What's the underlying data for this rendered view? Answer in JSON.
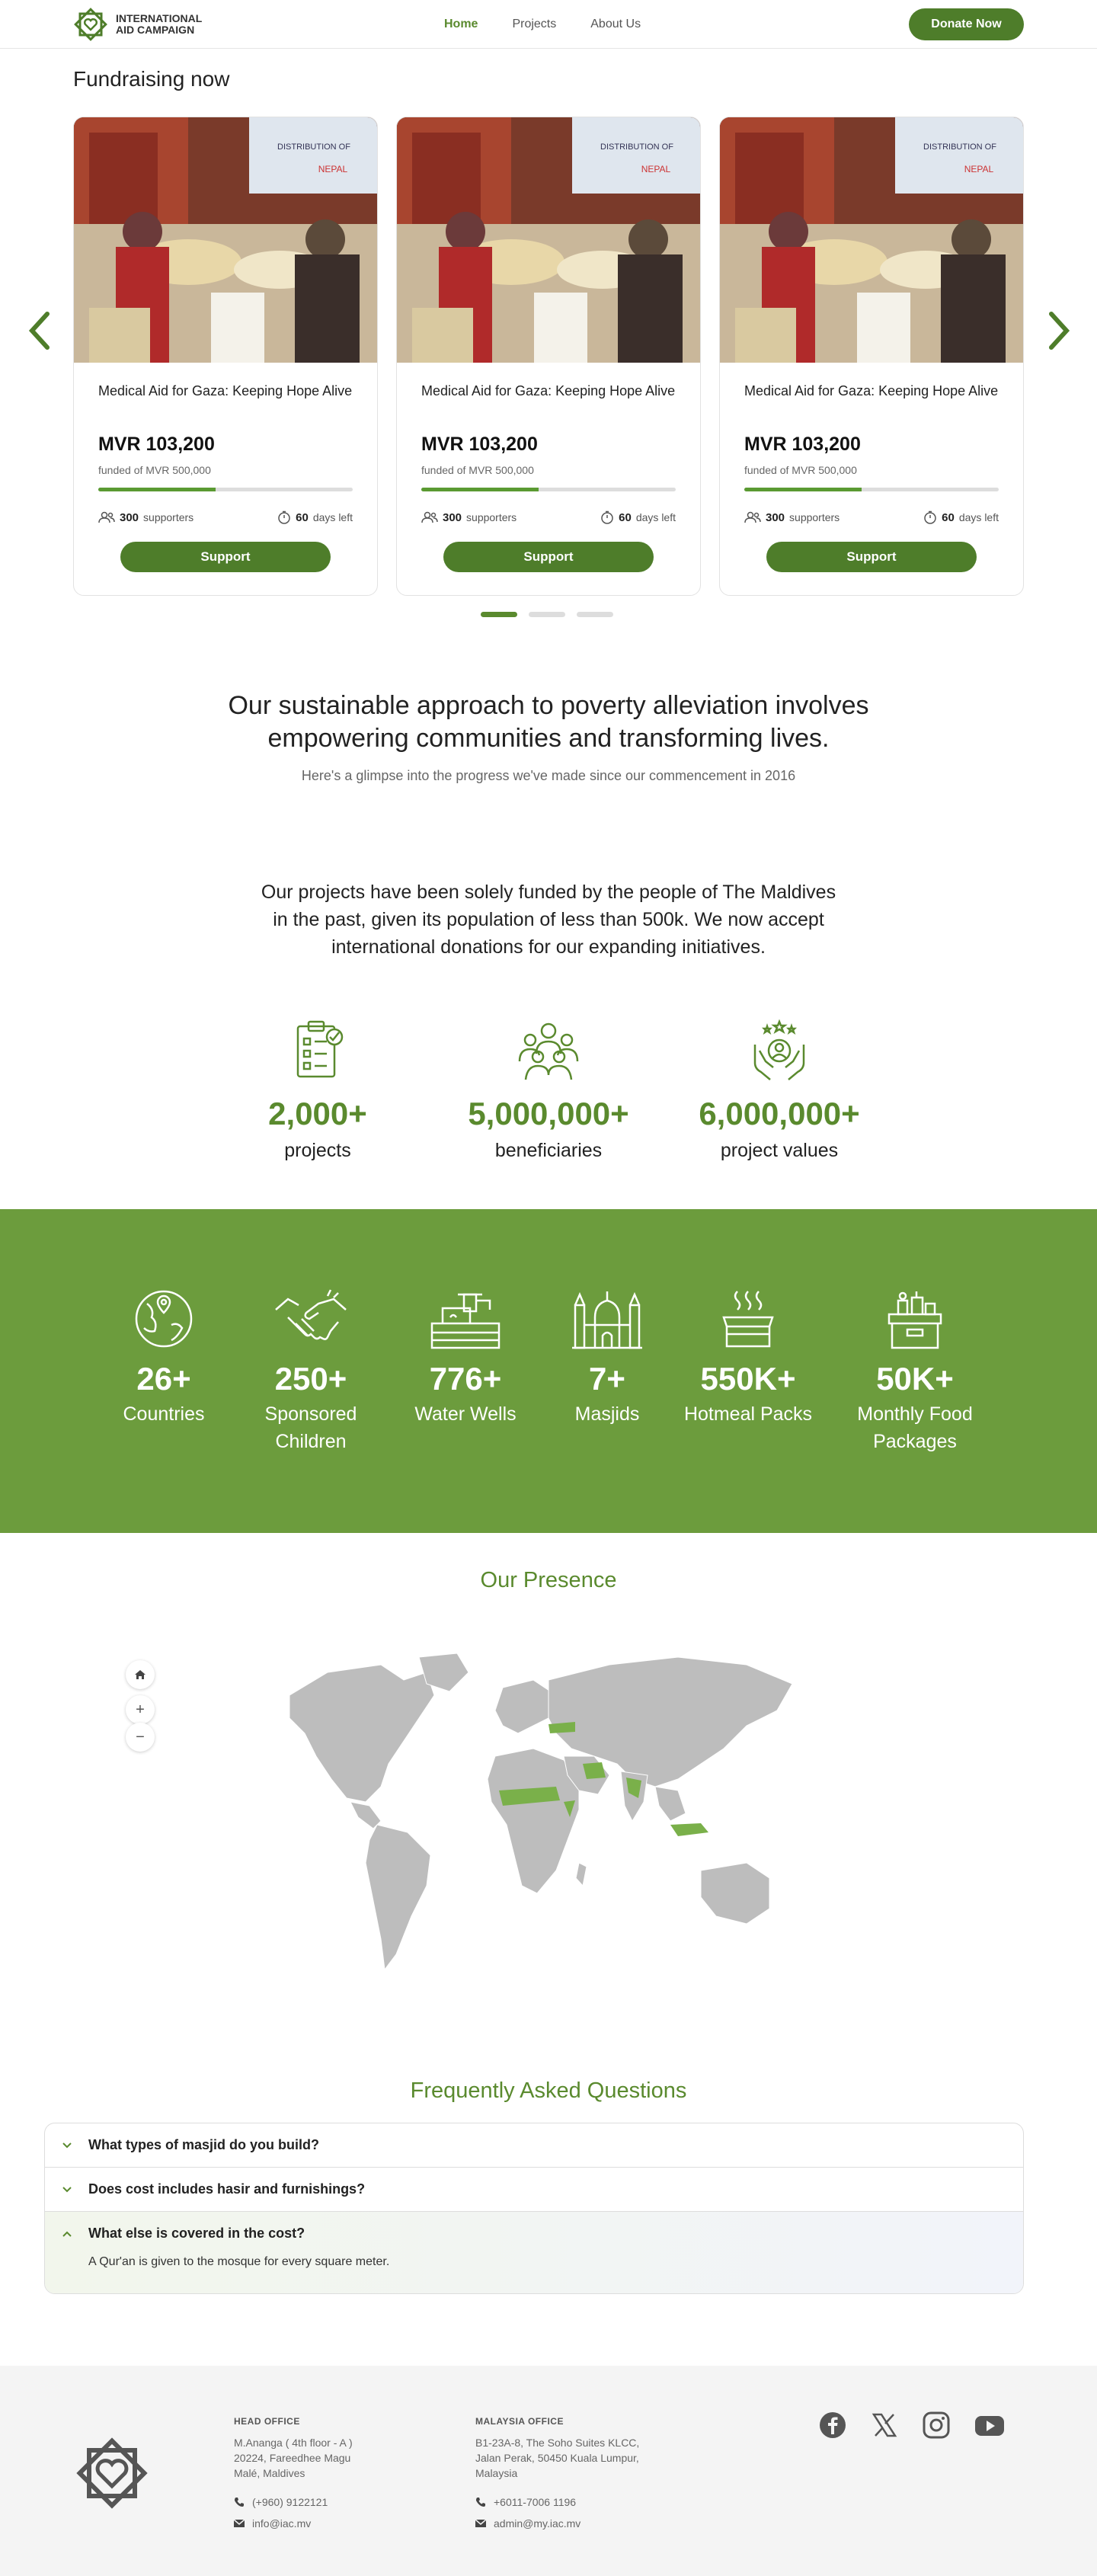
{
  "header": {
    "logo_line1": "INTERNATIONAL",
    "logo_line2": "AID CAMPAIGN",
    "nav": [
      "Home",
      "Projects",
      "About Us"
    ],
    "donate_label": "Donate Now"
  },
  "fundraising": {
    "heading": "Fundraising now",
    "cards": [
      {
        "title": "Medical Aid for Gaza: Keeping Hope Alive",
        "amount": "MVR 103,200",
        "funded": "funded of MVR 500,000",
        "progress": 0.46,
        "supporters": "300",
        "supporters_label": "supporters",
        "days": "60",
        "days_label": "days left",
        "button": "Support"
      },
      {
        "title": "Medical Aid for Gaza: Keeping Hope Alive",
        "amount": "MVR 103,200",
        "funded": "funded of MVR 500,000",
        "progress": 0.46,
        "supporters": "300",
        "supporters_label": "supporters",
        "days": "60",
        "days_label": "days left",
        "button": "Support"
      },
      {
        "title": "Medical Aid for Gaza: Keeping Hope Alive",
        "amount": "MVR 103,200",
        "funded": "funded of MVR 500,000",
        "progress": 0.46,
        "supporters": "300",
        "supporters_label": "supporters",
        "days": "60",
        "days_label": "days left",
        "button": "Support"
      }
    ],
    "image_banner_text": "DISTRIBUTION OF",
    "image_banner_sub": "NEPAL",
    "active_slide": 1,
    "slide_count": 3
  },
  "mission": {
    "headline_line1": "Our sustainable approach to poverty alleviation involves",
    "headline_line2": "empowering communities and transforming lives.",
    "subtext": "Here's a glimpse into the progress we've made since our commencement in 2016"
  },
  "funding": {
    "line1": "Our projects have been solely funded by the people of The Maldives",
    "line2": "in the past, given its population of less than 500k. We now accept",
    "line3": "international donations for our expanding initiatives."
  },
  "impact": [
    {
      "icon": "clipboard-check-icon",
      "value": "2,000+",
      "label": "projects"
    },
    {
      "icon": "community-icon",
      "value": "5,000,000+",
      "label": "beneficiaries"
    },
    {
      "icon": "hands-star-icon",
      "value": "6,000,000+",
      "label": "project values"
    }
  ],
  "achievements": [
    {
      "icon": "globe-icon",
      "value": "26+",
      "label": "Countries"
    },
    {
      "icon": "handshake-icon",
      "value": "250+",
      "label": "Sponsored Children"
    },
    {
      "icon": "water-well-icon",
      "value": "776+",
      "label": "Water Wells"
    },
    {
      "icon": "masjid-icon",
      "value": "7+",
      "label": "Masjids"
    },
    {
      "icon": "hot-meal-icon",
      "value": "550K+",
      "label": "Hotmeal Packs"
    },
    {
      "icon": "food-package-icon",
      "value": "50K+",
      "label": "Monthly Food Packages"
    }
  ],
  "presence": {
    "title": "Our Presence"
  },
  "faq": {
    "title": "Frequently Asked Questions",
    "items": [
      {
        "q": "What types of masjid do you build?",
        "open": false
      },
      {
        "q": "Does cost includes hasir and furnishings?",
        "open": false
      },
      {
        "q": "What else is covered in the cost?",
        "open": true,
        "a": "A Qur'an is given to the mosque for every square meter."
      }
    ]
  },
  "footer": {
    "head_office": {
      "heading": "HEAD OFFICE",
      "address1": "M.Ananga ( 4th floor - A )",
      "address2": "20224, Fareedhee Magu",
      "address3": "Malé, Maldives",
      "phone": "(+960) 9122121",
      "email": "info@iac.mv"
    },
    "malaysia_office": {
      "heading": "MALAYSIA OFFICE",
      "address1": "B1-23A-8, The Soho Suites KLCC,",
      "address2": "Jalan Perak, 50450 Kuala Lumpur,",
      "address3": "Malaysia",
      "phone": "+6011-7006 1196",
      "email": "admin@my.iac.mv"
    },
    "social": [
      "facebook-icon",
      "x-icon",
      "instagram-icon",
      "youtube-icon"
    ]
  },
  "colors": {
    "brand_green": "#4e7d2a",
    "band_green": "#6c9c3d",
    "accent_text": "#5a8a2e"
  }
}
